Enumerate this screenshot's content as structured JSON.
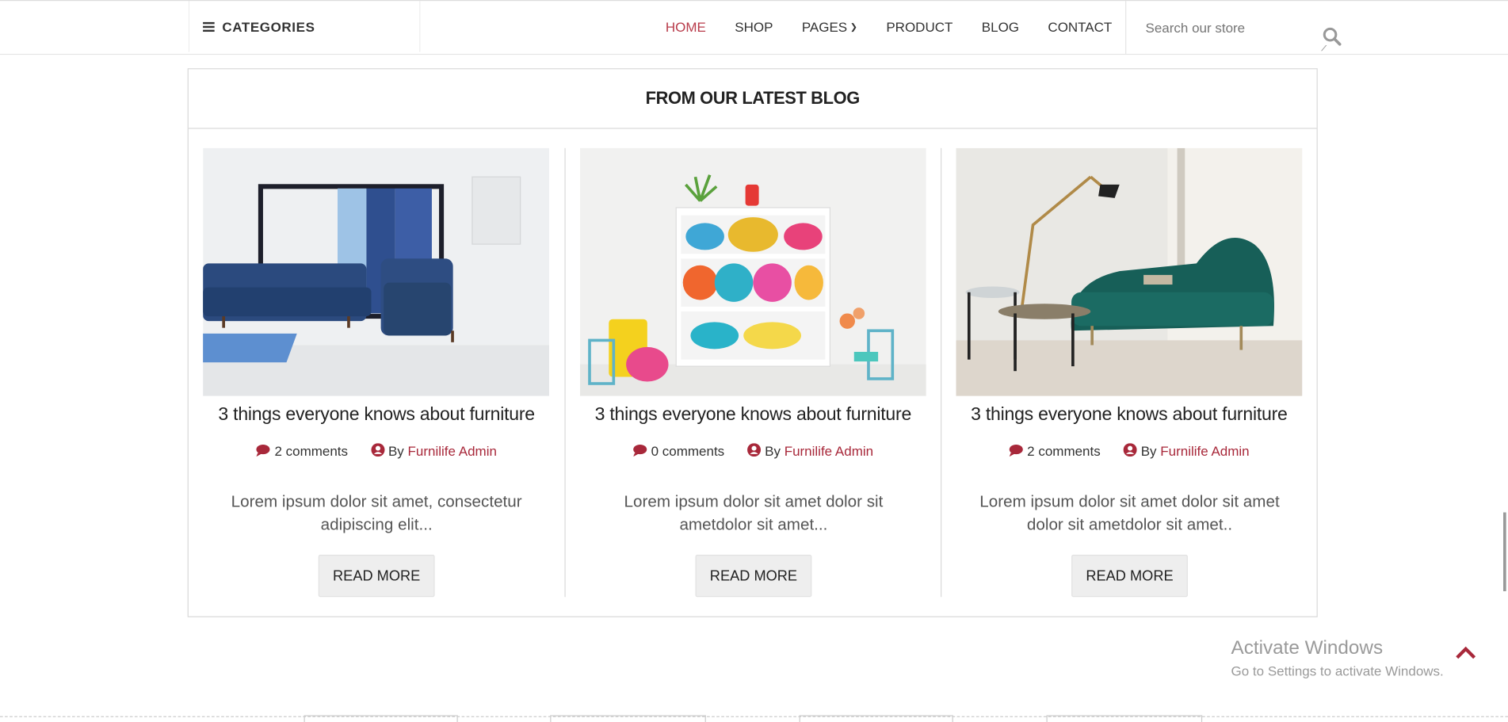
{
  "header": {
    "categories_label": "CATEGORIES",
    "nav": [
      "HOME",
      "SHOP",
      "PAGES",
      "PRODUCT",
      "BLOG",
      "CONTACT"
    ],
    "active_nav": "HOME",
    "search_placeholder": "Search our store"
  },
  "blog": {
    "heading": "FROM OUR LATEST BLOG",
    "posts": [
      {
        "title": "3 things everyone knows about furniture",
        "comments": "2 comments",
        "by": "By",
        "author": "Furnilife Admin",
        "excerpt": "Lorem ipsum dolor sit amet, consectetur adipiscing elit...",
        "button": "READ MORE"
      },
      {
        "title": "3 things everyone knows about furniture",
        "comments": "0 comments",
        "by": "By",
        "author": "Furnilife Admin",
        "excerpt": "Lorem ipsum dolor sit amet dolor sit ametdolor sit amet...",
        "button": "READ MORE"
      },
      {
        "title": "3 things everyone knows about furniture",
        "comments": "2 comments",
        "by": "By",
        "author": "Furnilife Admin",
        "excerpt": "Lorem ipsum dolor sit amet dolor sit amet dolor sit ametdolor sit amet..",
        "button": "READ MORE"
      }
    ]
  },
  "os_overlay": {
    "title": "Activate Windows",
    "subtitle": "Go to Settings to activate Windows."
  },
  "colors": {
    "accent": "#a8283a",
    "active_nav": "#b83b4a"
  }
}
